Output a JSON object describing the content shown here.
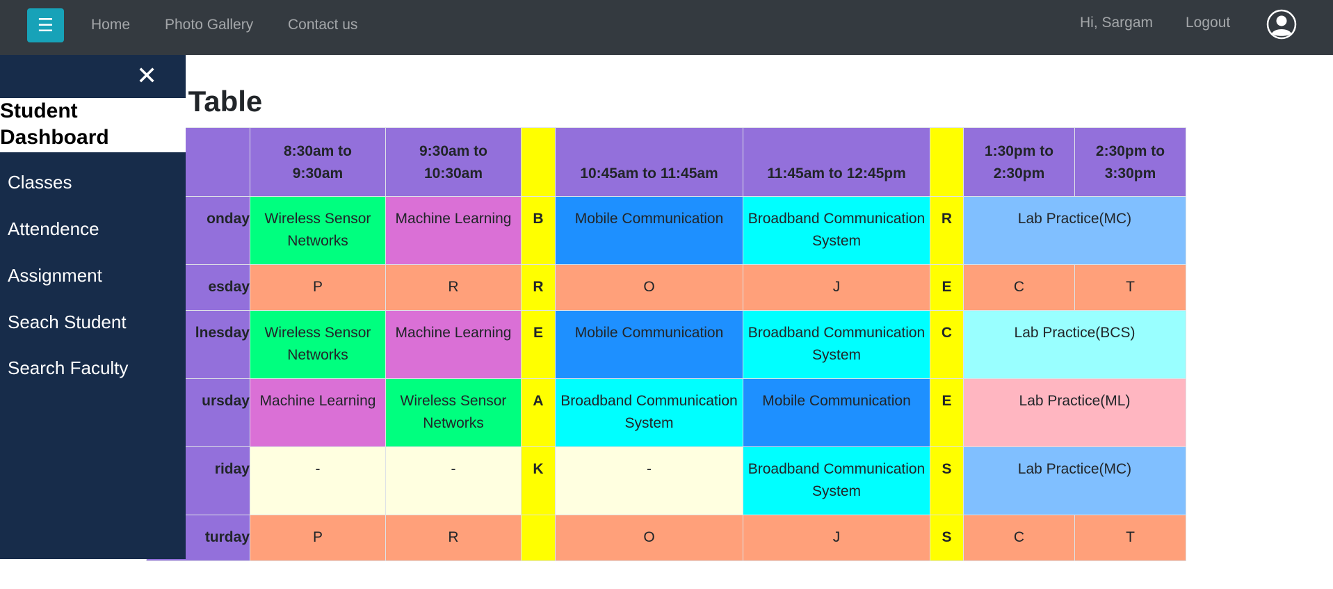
{
  "navbar": {
    "menu_icon": "hamburger-icon",
    "menu_glyph": "☰",
    "links": [
      "Home",
      "Photo Gallery",
      "Contact us"
    ],
    "greeting": "Hi, Sargam",
    "logout": "Logout",
    "avatar_icon": "user-avatar-icon"
  },
  "colors": {
    "navbar": "#343a40",
    "menu_button": "#17a2b8",
    "sidebar": "#172c4a",
    "header_purple": "#9370db",
    "break_yellow": "#ffff00",
    "wsn": "#00ff7f",
    "ml": "#da70d6",
    "mc": "#1e90ff",
    "bcs": "#00ffff",
    "peach": "#ffa07a",
    "lab_mc": "#80bfff",
    "lab_bcs": "#99ffff",
    "lab_ml": "#ffb6c1",
    "empty": "#ffffe0"
  },
  "page": {
    "title_visible": "ne Table"
  },
  "sidebar": {
    "close_icon": "close-icon",
    "close_glyph": "✕",
    "title_line1": "Student",
    "title_line2": "Dashboard",
    "items": [
      "Classes",
      "Attendence",
      "Assignment",
      "Seach Student",
      "Search Faculty"
    ]
  },
  "timetable": {
    "headers": {
      "slot1_l1": "8:30am to",
      "slot1_l2": "9:30am",
      "slot2_l1": "9:30am to",
      "slot2_l2": "10:30am",
      "slot3": "10:45am to 11:45am",
      "slot4": "11:45am to 12:45pm",
      "slot5_l1": "1:30pm to",
      "slot5_l2": "2:30pm",
      "slot6_l1": "2:30pm to",
      "slot6_l2": "3:30pm"
    },
    "rows": [
      {
        "day": "onday",
        "c1": "Wireless Sensor Networks",
        "c2": "Machine Learning",
        "b1": "B",
        "c3": "Mobile Communication",
        "c4": "Broadband Communication System",
        "b2": "R",
        "c5": "Lab Practice(MC)"
      },
      {
        "day": "esday",
        "c1": "P",
        "c2": "R",
        "b1": "R",
        "c3": "O",
        "c4": "J",
        "b2": "E",
        "c5": "C",
        "c6": "T"
      },
      {
        "day": "lnesday",
        "c1": "Wireless Sensor Networks",
        "c2": "Machine Learning",
        "b1": "E",
        "c3": "Mobile Communication",
        "c4": "Broadband Communication System",
        "b2": "C",
        "c5": "Lab Practice(BCS)"
      },
      {
        "day": "ursday",
        "c1": "Machine Learning",
        "c2": "Wireless Sensor Networks",
        "b1": "A",
        "c3": "Broadband Communication System",
        "c4": "Mobile Communication",
        "b2": "E",
        "c5": "Lab Practice(ML)"
      },
      {
        "day": "riday",
        "c1": "-",
        "c2": "-",
        "b1": "K",
        "c3": "-",
        "c4": "Broadband Communication System",
        "b2": "S",
        "c5": "Lab Practice(MC)"
      },
      {
        "day": "turday",
        "c1": "P",
        "c2": "R",
        "b1": "",
        "c3": "O",
        "c4": "J",
        "b2": "S",
        "c5": "C",
        "c6": "T"
      }
    ]
  }
}
